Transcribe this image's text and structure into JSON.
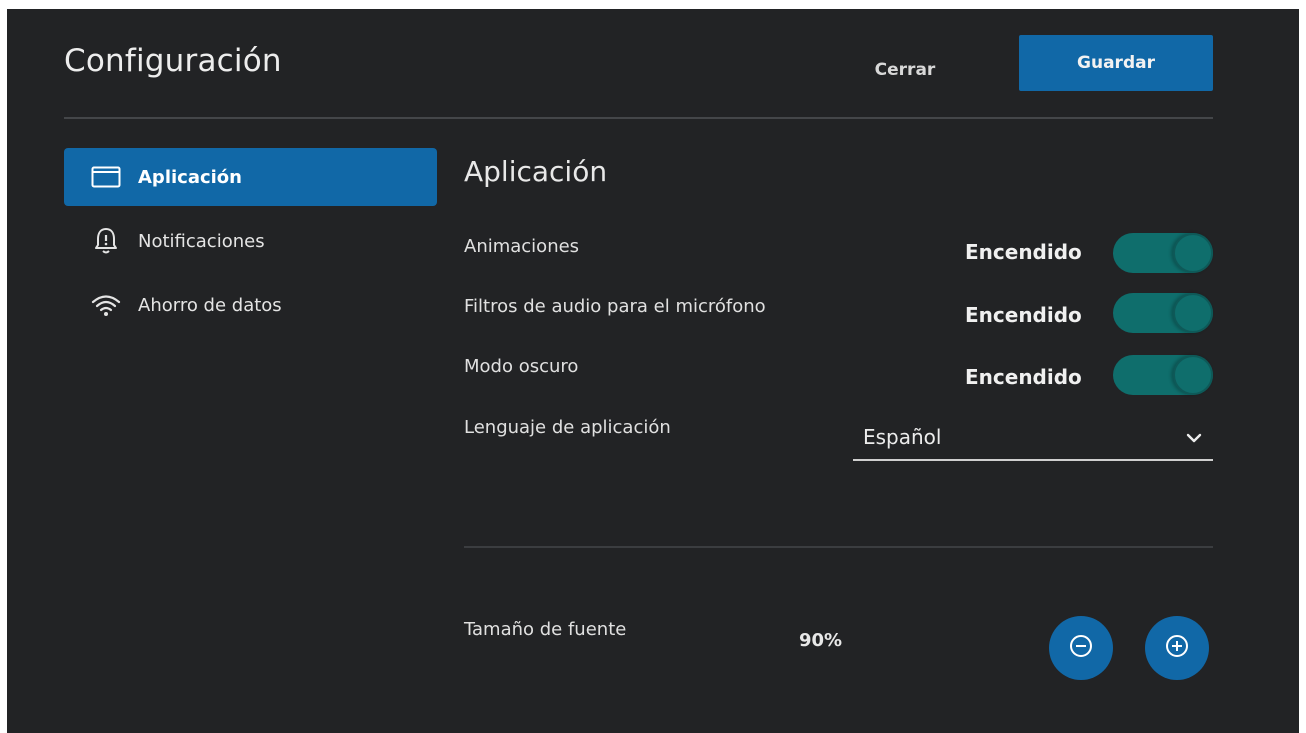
{
  "header": {
    "title": "Configuración",
    "close_label": "Cerrar",
    "save_label": "Guardar"
  },
  "sidebar": {
    "items": [
      {
        "label": "Aplicación",
        "icon": "window-icon",
        "active": true
      },
      {
        "label": "Notificaciones",
        "icon": "bell-alert-icon",
        "active": false
      },
      {
        "label": "Ahorro de datos",
        "icon": "wifi-icon",
        "active": false
      }
    ]
  },
  "main": {
    "section_title": "Aplicación",
    "settings": [
      {
        "label": "Animaciones",
        "state": "Encendido",
        "on": true
      },
      {
        "label": "Filtros de audio para el micrófono",
        "state": "Encendido",
        "on": true
      },
      {
        "label": "Modo oscuro",
        "state": "Encendido",
        "on": true
      }
    ],
    "language": {
      "label": "Lenguaje de aplicación",
      "value": "Español"
    },
    "font_size": {
      "label": "Tamaño de fuente",
      "value": "90%"
    }
  },
  "colors": {
    "accent": "#1168a7",
    "toggle_on": "#0f6e6c",
    "background": "#222325"
  }
}
